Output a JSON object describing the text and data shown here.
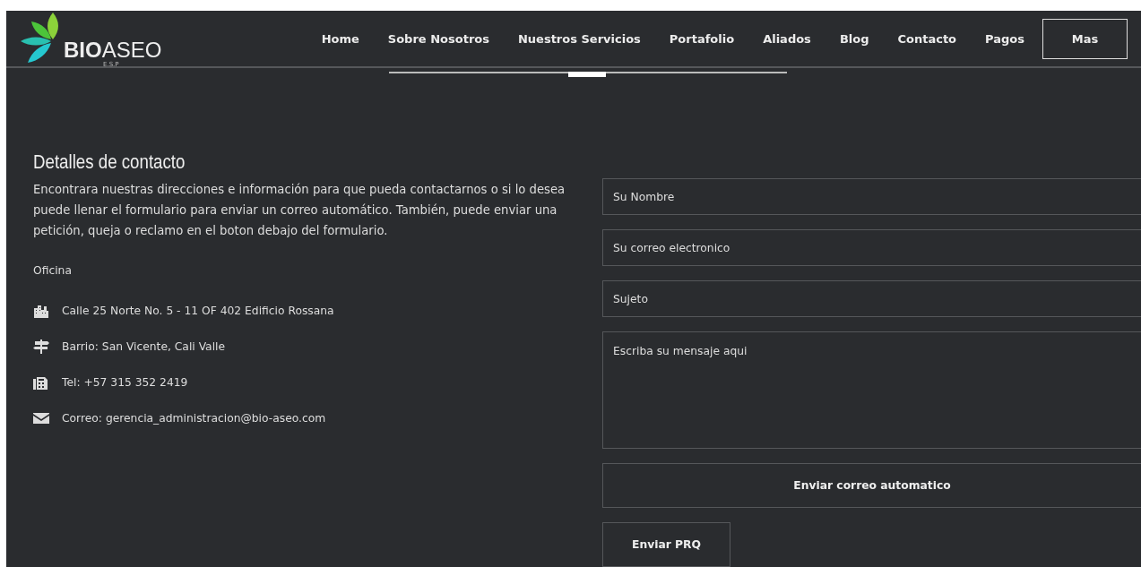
{
  "header": {
    "logo": {
      "name": "BIO",
      "name_light": "ASEO",
      "suffix": "E.S.P"
    },
    "nav": [
      {
        "label": "Home"
      },
      {
        "label": "Sobre Nosotros"
      },
      {
        "label": "Nuestros Servicios"
      },
      {
        "label": "Portafolio"
      },
      {
        "label": "Aliados"
      },
      {
        "label": "Blog"
      },
      {
        "label": "Contacto"
      },
      {
        "label": "Pagos"
      }
    ],
    "more_button": "Mas"
  },
  "contact": {
    "title": "Detalles de contacto",
    "description": "Encontrara nuestras direcciones e información para que pueda contactarnos o si lo desea puede llenar el formulario para enviar un correo automático. También, puede enviar una petición, queja o reclamo en el boton debajo del formulario.",
    "office_label": "Oficina",
    "items": [
      {
        "kind": "building",
        "text": "Calle 25 Norte No. 5 - 11 OF 402 Edificio Rossana"
      },
      {
        "kind": "signpost",
        "text": "Barrio: San Vicente, Cali Valle"
      },
      {
        "kind": "fax",
        "text": "Tel: +57 315 352 2419"
      },
      {
        "kind": "mail",
        "text": "Correo: gerencia_administracion@bio-aseo.com"
      }
    ]
  },
  "form": {
    "fields": [
      {
        "kind": "input",
        "placeholder": "Su Nombre"
      },
      {
        "kind": "input",
        "placeholder": "Su correo electronico"
      },
      {
        "kind": "input",
        "placeholder": "Sujeto"
      },
      {
        "kind": "textarea",
        "placeholder": "Escriba su mensaje aqui"
      }
    ],
    "submit_button": "Enviar correo automatico",
    "prq_button": "Enviar PRQ"
  }
}
